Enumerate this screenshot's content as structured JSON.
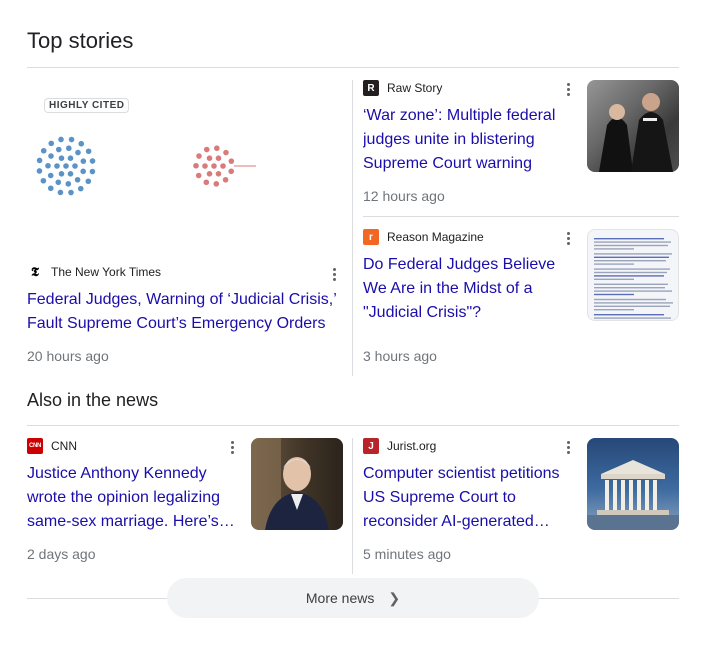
{
  "top_stories": {
    "title": "Top stories",
    "featured": {
      "badge": "HIGHLY CITED",
      "source": "The New York Times",
      "favicon_letter": "𝕿",
      "headline": "Federal Judges, Warning of ‘Judicial Crisis,’ Fault Supreme Court’s Emergency Orders",
      "time": "20 hours ago",
      "dot_colors": {
        "blue": "#5b93c7",
        "red": "#d77b7b"
      }
    },
    "side": [
      {
        "source": "Raw Story",
        "favicon_letter": "R",
        "favicon_color": "#c4161c",
        "headline": "‘War zone’: Multiple federal judges unite in blistering Supreme Court warning",
        "time": "12 hours ago",
        "thumb_icon": "judges-photo"
      },
      {
        "source": "Reason Magazine",
        "favicon_letter": "r",
        "favicon_color": "#f26722",
        "headline": "Do Federal Judges Believe We Are in the Midst of a \"Judicial Crisis\"?",
        "time": "3 hours ago",
        "thumb_icon": "document-photo"
      }
    ]
  },
  "also_in_news": {
    "title": "Also in the news",
    "items": [
      {
        "source": "CNN",
        "favicon_letter": "CNN",
        "favicon_color": "#cc0000",
        "headline": "Justice Anthony Kennedy wrote the opinion legalizing same-sex marriage. Here’s…",
        "time": "2 days ago",
        "thumb_icon": "portrait-photo"
      },
      {
        "source": "Jurist.org",
        "favicon_letter": "J",
        "favicon_color": "#b8242a",
        "headline": "Computer scientist petitions US Supreme Court to reconsider AI-generated…",
        "time": "5 minutes ago",
        "thumb_icon": "supreme-court-building-photo"
      }
    ]
  },
  "more_news_label": "More news"
}
